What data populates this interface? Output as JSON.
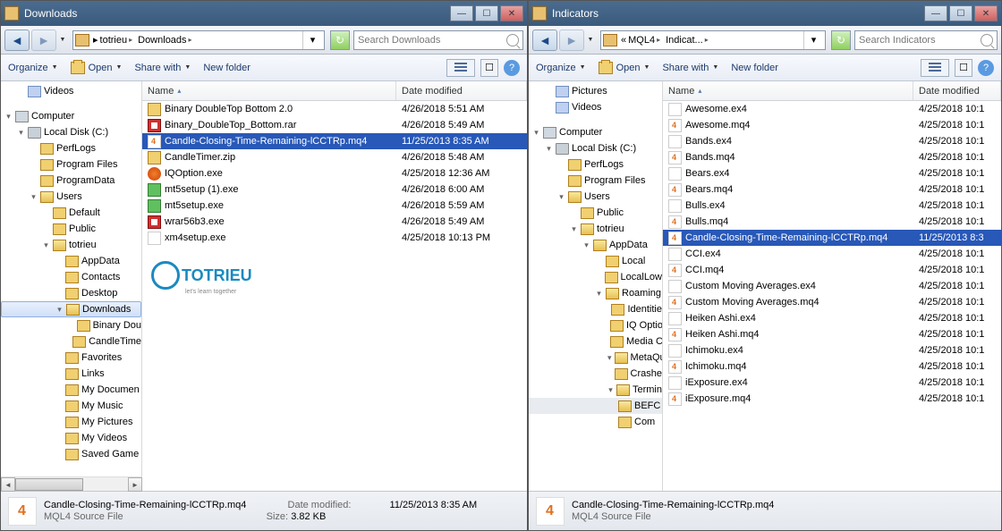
{
  "left": {
    "title": "Downloads",
    "breadcrumbs": [
      "totrieu",
      "Downloads"
    ],
    "searchPlaceholder": "Search Downloads",
    "toolbar": {
      "organize": "Organize",
      "open": "Open",
      "share": "Share with",
      "newfolder": "New folder"
    },
    "columns": {
      "name": "Name",
      "date": "Date modified"
    },
    "tree": [
      {
        "label": "Videos",
        "icon": "videos",
        "indent": 1
      },
      {
        "spacer": true
      },
      {
        "label": "Computer",
        "icon": "computer",
        "indent": 0,
        "exp": "▾"
      },
      {
        "label": "Local Disk (C:)",
        "icon": "drive",
        "indent": 1,
        "exp": "▾"
      },
      {
        "label": "PerfLogs",
        "icon": "folder",
        "indent": 2
      },
      {
        "label": "Program Files",
        "icon": "folder",
        "indent": 2
      },
      {
        "label": "ProgramData",
        "icon": "folder",
        "indent": 2
      },
      {
        "label": "Users",
        "icon": "folder open",
        "indent": 2,
        "exp": "▾"
      },
      {
        "label": "Default",
        "icon": "folder",
        "indent": 3
      },
      {
        "label": "Public",
        "icon": "folder",
        "indent": 3
      },
      {
        "label": "totrieu",
        "icon": "folder open",
        "indent": 3,
        "exp": "▾"
      },
      {
        "label": "AppData",
        "icon": "folder",
        "indent": 4
      },
      {
        "label": "Contacts",
        "icon": "folder",
        "indent": 4
      },
      {
        "label": "Desktop",
        "icon": "folder",
        "indent": 4
      },
      {
        "label": "Downloads",
        "icon": "folder open",
        "indent": 4,
        "exp": "▾",
        "sel": true
      },
      {
        "label": "Binary Dou",
        "icon": "folder",
        "indent": 5
      },
      {
        "label": "CandleTime",
        "icon": "folder",
        "indent": 5
      },
      {
        "label": "Favorites",
        "icon": "folder",
        "indent": 4
      },
      {
        "label": "Links",
        "icon": "folder",
        "indent": 4
      },
      {
        "label": "My Documen",
        "icon": "folder",
        "indent": 4
      },
      {
        "label": "My Music",
        "icon": "folder",
        "indent": 4
      },
      {
        "label": "My Pictures",
        "icon": "folder",
        "indent": 4
      },
      {
        "label": "My Videos",
        "icon": "folder",
        "indent": 4
      },
      {
        "label": "Saved Game",
        "icon": "folder",
        "indent": 4
      }
    ],
    "files": [
      {
        "name": "Binary DoubleTop  Bottom 2.0",
        "date": "4/26/2018 5:51 AM",
        "icon": "ficonFolder"
      },
      {
        "name": "Binary_DoubleTop_Bottom.rar",
        "date": "4/26/2018 5:49 AM",
        "icon": "ficonRar"
      },
      {
        "name": "Candle-Closing-Time-Remaining-lCCTRp.mq4",
        "date": "11/25/2013 8:35 AM",
        "icon": "ficonMq4",
        "sel": true
      },
      {
        "name": "CandleTimer.zip",
        "date": "4/26/2018 5:48 AM",
        "icon": "ficonZip"
      },
      {
        "name": "IQOption.exe",
        "date": "4/25/2018 12:36 AM",
        "icon": "ficonExeO"
      },
      {
        "name": "mt5setup (1).exe",
        "date": "4/26/2018 6:00 AM",
        "icon": "ficonExeG"
      },
      {
        "name": "mt5setup.exe",
        "date": "4/26/2018 5:59 AM",
        "icon": "ficonExeG"
      },
      {
        "name": "wrar56b3.exe",
        "date": "4/26/2018 5:49 AM",
        "icon": "ficonRar"
      },
      {
        "name": "xm4setup.exe",
        "date": "4/25/2018 10:13 PM",
        "icon": "ficonExe"
      }
    ],
    "status": {
      "name": "Candle-Closing-Time-Remaining-lCCTRp.mq4",
      "type": "MQL4 Source File",
      "dateLabel": "Date modified:",
      "date": "11/25/2013 8:35 AM",
      "sizeLabel": "Size:",
      "size": "3.82 KB"
    },
    "logo": {
      "text": "TOTRIEU",
      "sub": "let's learn together"
    }
  },
  "right": {
    "title": "Indicators",
    "breadcrumbs": [
      "MQL4",
      "Indicat..."
    ],
    "searchPlaceholder": "Search Indicators",
    "toolbar": {
      "organize": "Organize",
      "open": "Open",
      "share": "Share with",
      "newfolder": "New folder"
    },
    "columns": {
      "name": "Name",
      "date": "Date modified"
    },
    "tree": [
      {
        "label": "Pictures",
        "icon": "videos",
        "indent": 1
      },
      {
        "label": "Videos",
        "icon": "videos",
        "indent": 1
      },
      {
        "spacer": true
      },
      {
        "label": "Computer",
        "icon": "computer",
        "indent": 0,
        "exp": "▾"
      },
      {
        "label": "Local Disk (C:)",
        "icon": "drive",
        "indent": 1,
        "exp": "▾"
      },
      {
        "label": "PerfLogs",
        "icon": "folder",
        "indent": 2
      },
      {
        "label": "Program Files",
        "icon": "folder",
        "indent": 2
      },
      {
        "label": "Users",
        "icon": "folder open",
        "indent": 2,
        "exp": "▾"
      },
      {
        "label": "Public",
        "icon": "folder",
        "indent": 3
      },
      {
        "label": "totrieu",
        "icon": "folder open",
        "indent": 3,
        "exp": "▾"
      },
      {
        "label": "AppData",
        "icon": "folder open",
        "indent": 4,
        "exp": "▾"
      },
      {
        "label": "Local",
        "icon": "folder",
        "indent": 5
      },
      {
        "label": "LocalLow",
        "icon": "folder",
        "indent": 5
      },
      {
        "label": "Roaming",
        "icon": "folder open",
        "indent": 5,
        "exp": "▾"
      },
      {
        "label": "Identitie",
        "icon": "folder",
        "indent": 6
      },
      {
        "label": "IQ Optio",
        "icon": "folder",
        "indent": 6
      },
      {
        "label": "Media Ce",
        "icon": "folder",
        "indent": 6
      },
      {
        "label": "MetaQuo",
        "icon": "folder open",
        "indent": 6,
        "exp": "▾"
      },
      {
        "label": "Crashe",
        "icon": "folder",
        "indent": 6
      },
      {
        "label": "Termin",
        "icon": "folder open",
        "indent": 6,
        "exp": "▾"
      },
      {
        "label": "BEFC",
        "icon": "folder open",
        "indent": 6,
        "sel2": true
      },
      {
        "label": "Com",
        "icon": "folder",
        "indent": 6
      }
    ],
    "files": [
      {
        "name": "Awesome.ex4",
        "date": "4/25/2018 10:1",
        "icon": "ficonEx4"
      },
      {
        "name": "Awesome.mq4",
        "date": "4/25/2018 10:1",
        "icon": "ficonMq4"
      },
      {
        "name": "Bands.ex4",
        "date": "4/25/2018 10:1",
        "icon": "ficonEx4"
      },
      {
        "name": "Bands.mq4",
        "date": "4/25/2018 10:1",
        "icon": "ficonMq4"
      },
      {
        "name": "Bears.ex4",
        "date": "4/25/2018 10:1",
        "icon": "ficonEx4"
      },
      {
        "name": "Bears.mq4",
        "date": "4/25/2018 10:1",
        "icon": "ficonMq4"
      },
      {
        "name": "Bulls.ex4",
        "date": "4/25/2018 10:1",
        "icon": "ficonEx4"
      },
      {
        "name": "Bulls.mq4",
        "date": "4/25/2018 10:1",
        "icon": "ficonMq4"
      },
      {
        "name": "Candle-Closing-Time-Remaining-lCCTRp.mq4",
        "date": "11/25/2013 8:3",
        "icon": "ficonMq4",
        "sel": true
      },
      {
        "name": "CCI.ex4",
        "date": "4/25/2018 10:1",
        "icon": "ficonEx4"
      },
      {
        "name": "CCI.mq4",
        "date": "4/25/2018 10:1",
        "icon": "ficonMq4"
      },
      {
        "name": "Custom Moving Averages.ex4",
        "date": "4/25/2018 10:1",
        "icon": "ficonEx4"
      },
      {
        "name": "Custom Moving Averages.mq4",
        "date": "4/25/2018 10:1",
        "icon": "ficonMq4"
      },
      {
        "name": "Heiken Ashi.ex4",
        "date": "4/25/2018 10:1",
        "icon": "ficonEx4"
      },
      {
        "name": "Heiken Ashi.mq4",
        "date": "4/25/2018 10:1",
        "icon": "ficonMq4"
      },
      {
        "name": "Ichimoku.ex4",
        "date": "4/25/2018 10:1",
        "icon": "ficonEx4"
      },
      {
        "name": "Ichimoku.mq4",
        "date": "4/25/2018 10:1",
        "icon": "ficonMq4"
      },
      {
        "name": "iExposure.ex4",
        "date": "4/25/2018 10:1",
        "icon": "ficonEx4"
      },
      {
        "name": "iExposure.mq4",
        "date": "4/25/2018 10:1",
        "icon": "ficonMq4"
      }
    ],
    "status": {
      "name": "Candle-Closing-Time-Remaining-lCCTRp.mq4",
      "type": "MQL4 Source File"
    }
  }
}
